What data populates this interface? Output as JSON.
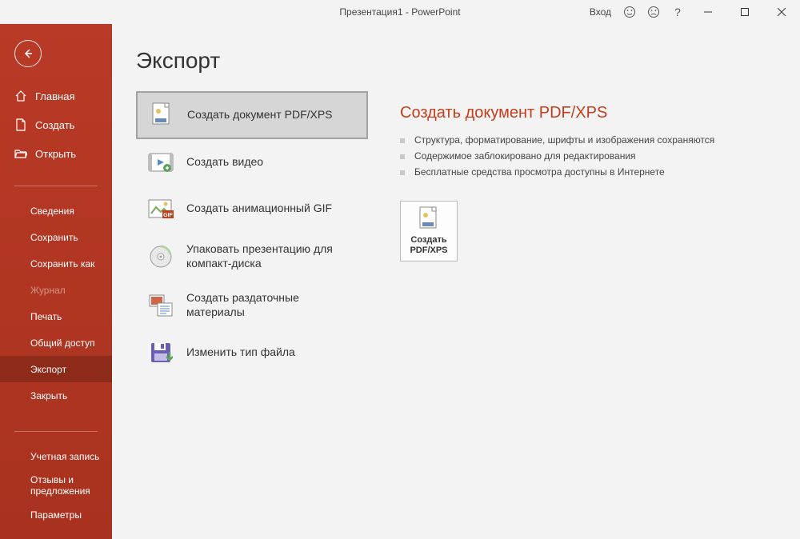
{
  "titlebar": {
    "title": "Презентация1 - PowerPoint",
    "login": "Вход"
  },
  "sidebar": {
    "primary": [
      {
        "key": "home",
        "label": "Главная"
      },
      {
        "key": "new",
        "label": "Создать"
      },
      {
        "key": "open",
        "label": "Открыть"
      }
    ],
    "secondary": [
      {
        "key": "info",
        "label": "Сведения"
      },
      {
        "key": "save",
        "label": "Сохранить"
      },
      {
        "key": "saveas",
        "label": "Сохранить как"
      },
      {
        "key": "history",
        "label": "Журнал",
        "disabled": true
      },
      {
        "key": "print",
        "label": "Печать"
      },
      {
        "key": "share",
        "label": "Общий доступ"
      },
      {
        "key": "export",
        "label": "Экспорт",
        "selected": true
      },
      {
        "key": "close",
        "label": "Закрыть"
      }
    ],
    "bottom": [
      {
        "key": "account",
        "label": "Учетная запись"
      },
      {
        "key": "feedback",
        "label": "Отзывы и предложения"
      },
      {
        "key": "options",
        "label": "Параметры"
      }
    ]
  },
  "content": {
    "title": "Экспорт",
    "options": [
      {
        "key": "pdfxps",
        "label": "Создать документ PDF/XPS",
        "selected": true
      },
      {
        "key": "video",
        "label": "Создать видео"
      },
      {
        "key": "gif",
        "label": "Создать анимационный GIF"
      },
      {
        "key": "package",
        "label": "Упаковать презентацию для компакт-диска"
      },
      {
        "key": "handouts",
        "label": "Создать раздаточные материалы"
      },
      {
        "key": "changetype",
        "label": "Изменить тип файла"
      }
    ],
    "detail": {
      "title": "Создать документ PDF/XPS",
      "bullets": [
        "Структура, форматирование, шрифты и изображения сохраняются",
        "Содержимое заблокировано для редактирования",
        "Бесплатные средства просмотра доступны в Интернете"
      ],
      "action": "Создать PDF/XPS"
    }
  }
}
